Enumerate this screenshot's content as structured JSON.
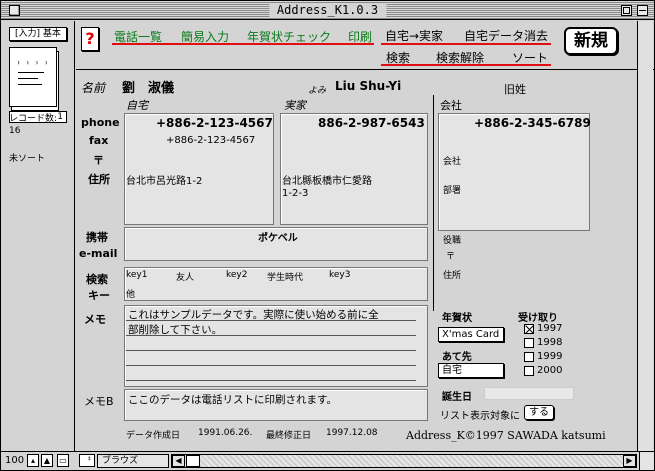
{
  "window": {
    "title": "Address_K1.0.3"
  },
  "status": {
    "layout_label": "[入力] 基本",
    "page_number": "1",
    "record_count_label": "レコード数:",
    "record_count": "16",
    "sort_status": "未ソート"
  },
  "toolbar": {
    "help": "?",
    "nav": [
      "電話一覧",
      "簡易入力",
      "年賀状チェック",
      "印刷"
    ],
    "buttons_row1": [
      "自宅→実家",
      "自宅データ消去"
    ],
    "buttons_row2": [
      "検索",
      "検索解除",
      "ソート"
    ],
    "new_label": "新規"
  },
  "record": {
    "name_label": "名前",
    "name": "劉　淑儀",
    "yomi_label": "よみ",
    "yomi": "Liu  Shu-Yi",
    "maiden_label": "旧姓",
    "col_home": "自宅",
    "col_parents": "実家",
    "col_company": "会社",
    "phone_label": "phone",
    "fax_label": "fax",
    "zip_label": "〒",
    "address_label": "住所",
    "home_phone": "+886-2-123-4567",
    "home_fax": "+886-2-123-4567",
    "home_address": "台北市呂光路1-2",
    "parents_phone": "886-2-987-6543",
    "parents_address_1": "台北縣板橋市仁愛路",
    "parents_address_2": "1-2-3",
    "company_phone": "+886-2-345-6789",
    "company_label": "会社",
    "dept_label": "部署",
    "title_label": "役職",
    "company_zip_label": "〒",
    "company_address_label": "住所",
    "mobile_label": "携帯",
    "email_label": "e-mail",
    "mobile": "ポケベル",
    "search_key_label_1": "検索",
    "search_key_label_2": "キー",
    "keys": [
      "key1",
      "友人",
      "key2",
      "学生時代",
      "key3"
    ],
    "key_other": "他",
    "memo_label": "メモ",
    "memo_line1": "これはサンプルデータです。実際に使い始める前に全",
    "memo_line2": "部削除して下さい。",
    "memob_label": "メモB",
    "memob": "ここのデータは電話リストに印刷されます。",
    "created_label": "データ作成日",
    "created": "1991.06.26.",
    "modified_label": "最終修正日",
    "modified": "1997.12.08"
  },
  "nenga": {
    "label": "年賀状",
    "type": "X'mas Card",
    "received_label": "受け取り",
    "years": [
      {
        "year": "1997",
        "checked": true
      },
      {
        "year": "1998",
        "checked": false
      },
      {
        "year": "1999",
        "checked": false
      },
      {
        "year": "2000",
        "checked": false
      }
    ],
    "dest_label": "あて先",
    "dest": "自宅",
    "birthday_label": "誕生日",
    "list_label": "リスト表示対象に",
    "list_button": "する"
  },
  "footer": {
    "copyright": "Address_K©1997 SAWADA katsumi",
    "zoom": "100",
    "mode": "ブラウズ"
  },
  "colors": {
    "nav_green": "#0a7a1a",
    "help_red": "#dd0000",
    "underline_red": "#e01010"
  }
}
